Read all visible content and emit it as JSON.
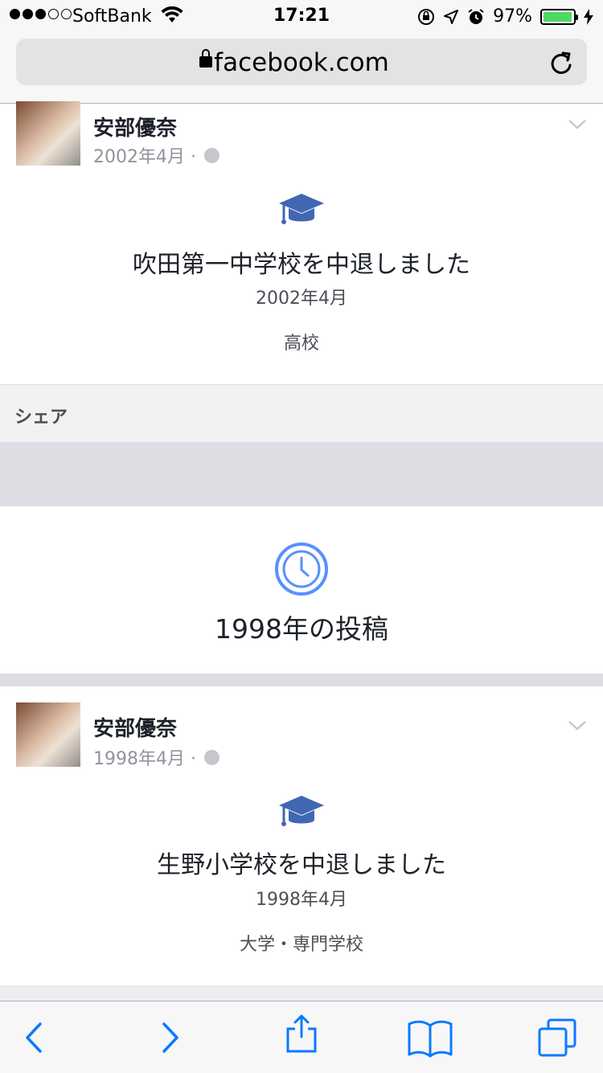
{
  "status_bar": {
    "carrier": "SoftBank",
    "time": "17:21",
    "battery": "97%",
    "battery_level": 0.97,
    "signal_bars": 3,
    "signal_total": 5
  },
  "browser": {
    "url": "facebook.com"
  },
  "posts": [
    {
      "author": "安部優奈",
      "meta_date": "2002年4月 ·",
      "event_title": "吹田第一中学校を中退しました",
      "event_date": "2002年4月",
      "event_type": "高校"
    },
    {
      "author": "安部優奈",
      "meta_date": "1998年4月 ·",
      "event_title": "生野小学校を中退しました",
      "event_date": "1998年4月",
      "event_type": "大学・専門学校"
    }
  ],
  "share": {
    "label": "シェア"
  },
  "year_section": {
    "label": "1998年の投稿"
  },
  "colors": {
    "accent_blue": "#4267b2",
    "ios_blue": "#0a7aff",
    "clock_blue": "#5890ff",
    "battery_green": "#4cd964"
  },
  "icons": {
    "graduation": "graduation-cap-icon",
    "clock": "clock-icon",
    "globe": "globe-icon",
    "lock": "lock-icon",
    "reload": "reload-icon"
  }
}
